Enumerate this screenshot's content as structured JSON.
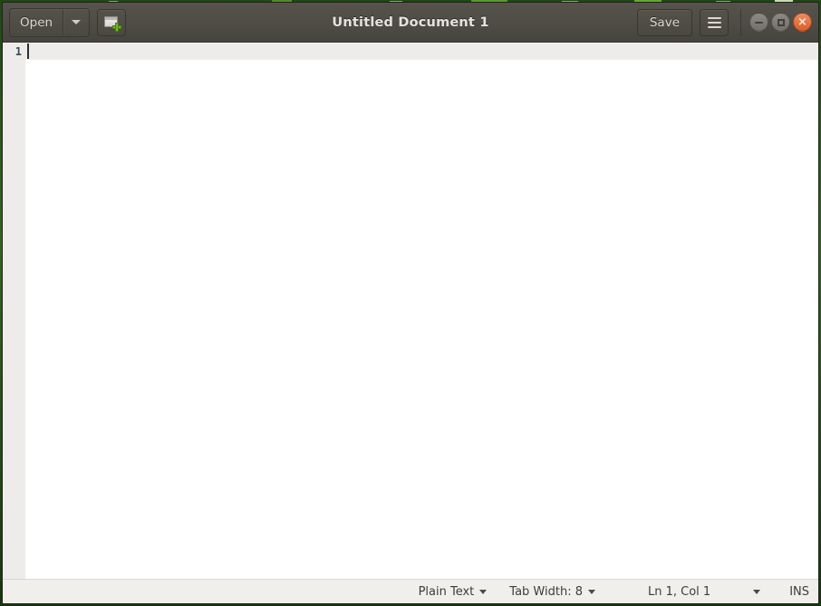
{
  "window": {
    "title": "Untitled Document 1"
  },
  "headerbar": {
    "open_label": "Open",
    "open_dropdown_icon": "chevron-down-icon",
    "new_document_icon": "new-document-icon",
    "save_label": "Save",
    "menu_icon": "hamburger-menu-icon",
    "minimize_icon": "minimize-icon",
    "maximize_icon": "maximize-icon",
    "close_icon": "close-icon",
    "close_glyph": "×"
  },
  "editor": {
    "line_numbers": [
      "1"
    ],
    "content": "",
    "cursor_visible": true
  },
  "statusbar": {
    "language": "Plain Text",
    "language_caret_icon": "chevron-down-icon",
    "tab_width": "Tab Width: 8",
    "tab_width_caret_icon": "chevron-down-icon",
    "position": "Ln 1, Col 1",
    "position_caret_icon": "chevron-down-icon",
    "insert_mode": "INS"
  },
  "colors": {
    "headerbar": "#4e4c45",
    "headerbar_text": "#e6e3dc",
    "button_face": "#4f4d46",
    "editor_bg": "#ffffff",
    "gutter_bg": "#edecea",
    "current_line": "#edecea",
    "statusbar_bg": "#f0efec",
    "statusbar_text": "#3c3c3a",
    "close_button": "#dc5c29",
    "accent_green": "#73b81f",
    "line_number": "#3b4a5c",
    "desktop": "#2c6b1a"
  }
}
